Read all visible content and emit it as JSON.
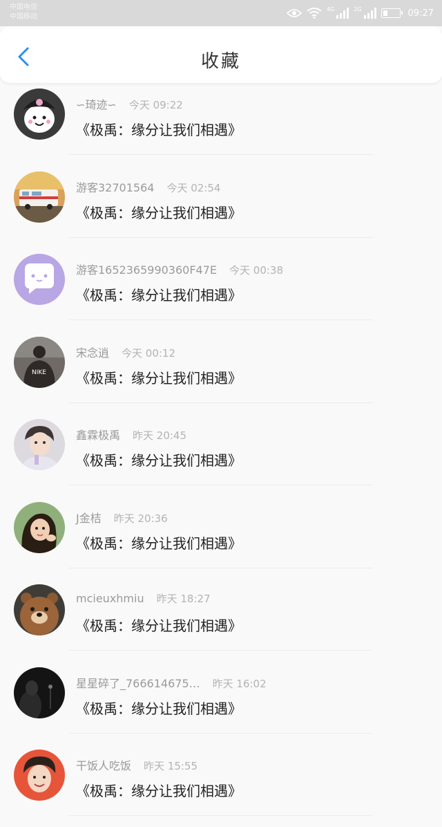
{
  "status_bar": {
    "carrier_line1": "中国电信",
    "carrier_line2": "中国移动",
    "network1": "4G",
    "network2": "2G",
    "time": "09:27",
    "battery_level": 0.3
  },
  "header": {
    "title": "收藏",
    "back_icon": "chevron-left-icon"
  },
  "colors": {
    "accent": "#2f8cf0",
    "status_bar_bg": "#d9d9d9",
    "name_text": "#9a9a9a",
    "time_text": "#b3b3b3"
  },
  "items": [
    {
      "name": "∽琦迹∽",
      "time": "今天 09:22",
      "message": "《极禹：缘分让我们相遇》",
      "avatar": "kuromi-avatar"
    },
    {
      "name": "游客32701564",
      "time": "今天 02:54",
      "message": "《极禹：缘分让我们相遇》",
      "avatar": "van-avatar"
    },
    {
      "name": "游客1652365990360F47E",
      "time": "今天 00:38",
      "message": "《极禹：缘分让我们相遇》",
      "avatar": "chat-bubble-avatar"
    },
    {
      "name": "宋念逍",
      "time": "今天 00:12",
      "message": "《极禹：缘分让我们相遇》",
      "avatar": "person-avatar"
    },
    {
      "name": "鑫霖极禹",
      "time": "昨天 20:45",
      "message": "《极禹：缘分让我们相遇》",
      "avatar": "boy-avatar"
    },
    {
      "name": "J金桔",
      "time": "昨天 20:36",
      "message": "《极禹：缘分让我们相遇》",
      "avatar": "girl-avatar"
    },
    {
      "name": "mcieuxhmiu",
      "time": "昨天 18:27",
      "message": "《极禹：缘分让我们相遇》",
      "avatar": "bear-avatar"
    },
    {
      "name": "星星碎了_766614675…",
      "time": "昨天 16:02",
      "message": "《极禹：缘分让我们相遇》",
      "avatar": "dark-avatar"
    },
    {
      "name": "干饭人吃饭",
      "time": "昨天 15:55",
      "message": "《极禹：缘分让我们相遇》",
      "avatar": "smile-boy-avatar"
    }
  ]
}
